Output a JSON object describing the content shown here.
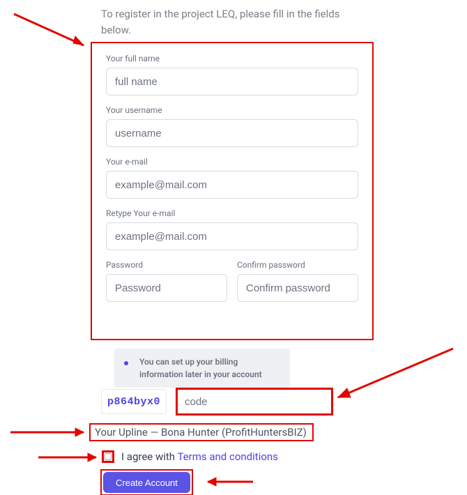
{
  "intro": "To register in the project LEQ, please fill in the fields below.",
  "fields": {
    "fullname": {
      "label": "Your full name",
      "placeholder": "full name"
    },
    "username": {
      "label": "Your username",
      "placeholder": "username"
    },
    "email": {
      "label": "Your e-mail",
      "placeholder": "example@mail.com"
    },
    "email2": {
      "label": "Retype Your e-mail",
      "placeholder": "example@mail.com"
    },
    "password": {
      "label": "Password",
      "placeholder": "Password"
    },
    "password2": {
      "label": "Confirm password",
      "placeholder": "Confirm password"
    }
  },
  "info_text": "You can set up your billing information later in your account",
  "captcha": {
    "image_text": "p864byx0",
    "placeholder": "code"
  },
  "upline_text": "Your Upline — Bona Hunter (ProfitHuntersBIZ)",
  "agree": {
    "prefix": "I agree with ",
    "link": "Terms and conditions"
  },
  "submit_label": "Create Account"
}
